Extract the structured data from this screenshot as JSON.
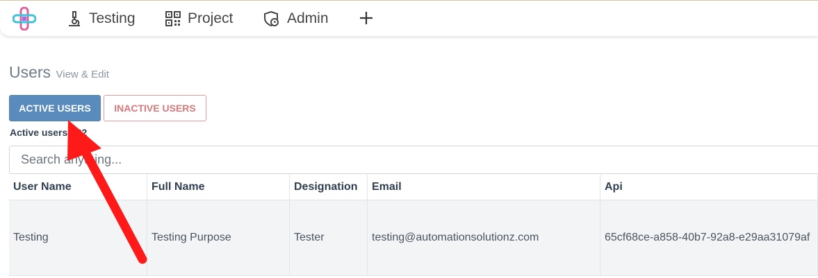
{
  "nav": {
    "items": [
      {
        "label": "Testing",
        "icon": "microscope-icon"
      },
      {
        "label": "Project",
        "icon": "qr-code-icon"
      },
      {
        "label": "Admin",
        "icon": "shield-clock-icon"
      }
    ],
    "add_icon": "plus-icon"
  },
  "page": {
    "title": "Users",
    "subtitle": "View & Edit"
  },
  "buttons": {
    "active": "ACTIVE USERS",
    "inactive": "INACTIVE USERS"
  },
  "count": {
    "label": "Active users : 62"
  },
  "search": {
    "placeholder": "Search anything..."
  },
  "table": {
    "headers": [
      "User Name",
      "Full Name",
      "Designation",
      "Email",
      "Api"
    ],
    "rows": [
      {
        "user_name": "Testing",
        "full_name": "Testing Purpose",
        "designation": "Tester",
        "email": "testing@automationsolutionz.com",
        "api": "65cf68ce-a858-40b7-92a8-e29aa31079af"
      }
    ]
  },
  "colors": {
    "accent": "#5a8bbd",
    "danger": "#d9787a",
    "annotation_arrow": "#ff1a1a"
  }
}
